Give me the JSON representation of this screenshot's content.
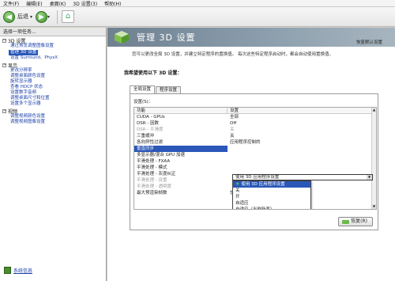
{
  "menu": [
    "文件(F)",
    "编辑(E)",
    "桌面(K)",
    "3D 设置(3)",
    "帮助(H)"
  ],
  "toolbar": {
    "back_label": "后退",
    "dropdown_glyph": "▾"
  },
  "sidebar": {
    "title": "选择一项任务...",
    "groups": [
      {
        "label": "3D 设置",
        "items": [
          "通过预览调整图像设置",
          "管理 3D 设置",
          "设置 Surround、PhysX"
        ],
        "selected_index": 1
      },
      {
        "label": "显示",
        "items": [
          "更改分辨率",
          "调整桌面颜色设置",
          "旋转显示器",
          "查看 HDCP 状态",
          "设置数字音频",
          "调整桌面尺寸和位置",
          "设置多个显示器"
        ]
      },
      {
        "label": "视频",
        "items": [
          "调整视频颜色设置",
          "调整视频图像设置"
        ]
      }
    ],
    "system_info": "系统信息"
  },
  "main": {
    "title": "管理 3D 设置",
    "restore_defaults": "恢复默认设置",
    "description": "您可以更改全局 3D 设置，并建立特定程序的置换值。 每次这些特定程序启动时，都会自动使用置换值。",
    "question": "我希望使用以下 3D 设置：",
    "tabs": [
      "全局设置",
      "程序设置"
    ],
    "settings_label": "设置(S)：",
    "columns": [
      "功能",
      "设置"
    ],
    "rows": [
      {
        "feature": "CUDA - GPUs",
        "value": "全部",
        "dim": false
      },
      {
        "feature": "DSR - 因数",
        "value": "Off",
        "dim": false
      },
      {
        "feature": "DSR - 平滑度",
        "value": "关",
        "dim": true
      },
      {
        "feature": "三重缓冲",
        "value": "关",
        "dim": false
      },
      {
        "feature": "各向异性过滤",
        "value": "应用程序控制的",
        "dim": false
      },
      {
        "feature": "垂直同步",
        "value": "",
        "dim": false,
        "selected": true
      },
      {
        "feature": "多显示器/混合 GPU 加速",
        "value": "",
        "dim": false
      },
      {
        "feature": "平滑处理 - FXAA",
        "value": "",
        "dim": false
      },
      {
        "feature": "平滑处理 - 模式",
        "value": "",
        "dim": false
      },
      {
        "feature": "平滑处理 - 灰度纠正",
        "value": "",
        "dim": false
      },
      {
        "feature": "平滑处理 - 设置",
        "value": "",
        "dim": true
      },
      {
        "feature": "平滑处理 - 透明度",
        "value": "",
        "dim": true
      },
      {
        "feature": "最大预渲染帧数",
        "value": "快",
        "dim": false
      }
    ],
    "combo_value": "使用 3D 应用程序设置",
    "dropdown_options": [
      "使用 3D 应用程序设置",
      "关",
      "开",
      "自适应",
      "自适应（半刷新率）"
    ],
    "dropdown_highlight": 0,
    "restore_button": "恢复(R)"
  }
}
